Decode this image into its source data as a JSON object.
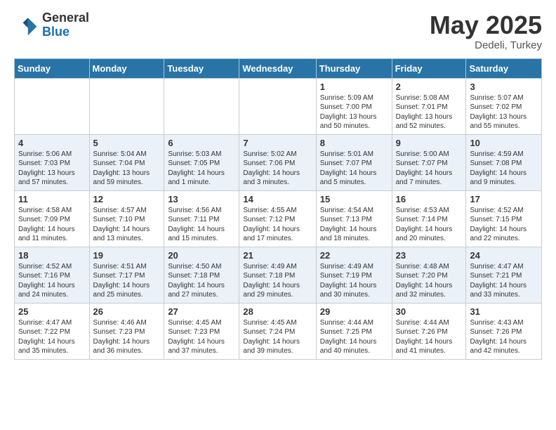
{
  "header": {
    "logo_general": "General",
    "logo_blue": "Blue",
    "month": "May 2025",
    "location": "Dedeli, Turkey"
  },
  "weekdays": [
    "Sunday",
    "Monday",
    "Tuesday",
    "Wednesday",
    "Thursday",
    "Friday",
    "Saturday"
  ],
  "weeks": [
    [
      {
        "day": "",
        "sunrise": "",
        "sunset": "",
        "daylight": ""
      },
      {
        "day": "",
        "sunrise": "",
        "sunset": "",
        "daylight": ""
      },
      {
        "day": "",
        "sunrise": "",
        "sunset": "",
        "daylight": ""
      },
      {
        "day": "",
        "sunrise": "",
        "sunset": "",
        "daylight": ""
      },
      {
        "day": "1",
        "sunrise": "Sunrise: 5:09 AM",
        "sunset": "Sunset: 7:00 PM",
        "daylight": "Daylight: 13 hours and 50 minutes."
      },
      {
        "day": "2",
        "sunrise": "Sunrise: 5:08 AM",
        "sunset": "Sunset: 7:01 PM",
        "daylight": "Daylight: 13 hours and 52 minutes."
      },
      {
        "day": "3",
        "sunrise": "Sunrise: 5:07 AM",
        "sunset": "Sunset: 7:02 PM",
        "daylight": "Daylight: 13 hours and 55 minutes."
      }
    ],
    [
      {
        "day": "4",
        "sunrise": "Sunrise: 5:06 AM",
        "sunset": "Sunset: 7:03 PM",
        "daylight": "Daylight: 13 hours and 57 minutes."
      },
      {
        "day": "5",
        "sunrise": "Sunrise: 5:04 AM",
        "sunset": "Sunset: 7:04 PM",
        "daylight": "Daylight: 13 hours and 59 minutes."
      },
      {
        "day": "6",
        "sunrise": "Sunrise: 5:03 AM",
        "sunset": "Sunset: 7:05 PM",
        "daylight": "Daylight: 14 hours and 1 minute."
      },
      {
        "day": "7",
        "sunrise": "Sunrise: 5:02 AM",
        "sunset": "Sunset: 7:06 PM",
        "daylight": "Daylight: 14 hours and 3 minutes."
      },
      {
        "day": "8",
        "sunrise": "Sunrise: 5:01 AM",
        "sunset": "Sunset: 7:07 PM",
        "daylight": "Daylight: 14 hours and 5 minutes."
      },
      {
        "day": "9",
        "sunrise": "Sunrise: 5:00 AM",
        "sunset": "Sunset: 7:07 PM",
        "daylight": "Daylight: 14 hours and 7 minutes."
      },
      {
        "day": "10",
        "sunrise": "Sunrise: 4:59 AM",
        "sunset": "Sunset: 7:08 PM",
        "daylight": "Daylight: 14 hours and 9 minutes."
      }
    ],
    [
      {
        "day": "11",
        "sunrise": "Sunrise: 4:58 AM",
        "sunset": "Sunset: 7:09 PM",
        "daylight": "Daylight: 14 hours and 11 minutes."
      },
      {
        "day": "12",
        "sunrise": "Sunrise: 4:57 AM",
        "sunset": "Sunset: 7:10 PM",
        "daylight": "Daylight: 14 hours and 13 minutes."
      },
      {
        "day": "13",
        "sunrise": "Sunrise: 4:56 AM",
        "sunset": "Sunset: 7:11 PM",
        "daylight": "Daylight: 14 hours and 15 minutes."
      },
      {
        "day": "14",
        "sunrise": "Sunrise: 4:55 AM",
        "sunset": "Sunset: 7:12 PM",
        "daylight": "Daylight: 14 hours and 17 minutes."
      },
      {
        "day": "15",
        "sunrise": "Sunrise: 4:54 AM",
        "sunset": "Sunset: 7:13 PM",
        "daylight": "Daylight: 14 hours and 18 minutes."
      },
      {
        "day": "16",
        "sunrise": "Sunrise: 4:53 AM",
        "sunset": "Sunset: 7:14 PM",
        "daylight": "Daylight: 14 hours and 20 minutes."
      },
      {
        "day": "17",
        "sunrise": "Sunrise: 4:52 AM",
        "sunset": "Sunset: 7:15 PM",
        "daylight": "Daylight: 14 hours and 22 minutes."
      }
    ],
    [
      {
        "day": "18",
        "sunrise": "Sunrise: 4:52 AM",
        "sunset": "Sunset: 7:16 PM",
        "daylight": "Daylight: 14 hours and 24 minutes."
      },
      {
        "day": "19",
        "sunrise": "Sunrise: 4:51 AM",
        "sunset": "Sunset: 7:17 PM",
        "daylight": "Daylight: 14 hours and 25 minutes."
      },
      {
        "day": "20",
        "sunrise": "Sunrise: 4:50 AM",
        "sunset": "Sunset: 7:18 PM",
        "daylight": "Daylight: 14 hours and 27 minutes."
      },
      {
        "day": "21",
        "sunrise": "Sunrise: 4:49 AM",
        "sunset": "Sunset: 7:18 PM",
        "daylight": "Daylight: 14 hours and 29 minutes."
      },
      {
        "day": "22",
        "sunrise": "Sunrise: 4:49 AM",
        "sunset": "Sunset: 7:19 PM",
        "daylight": "Daylight: 14 hours and 30 minutes."
      },
      {
        "day": "23",
        "sunrise": "Sunrise: 4:48 AM",
        "sunset": "Sunset: 7:20 PM",
        "daylight": "Daylight: 14 hours and 32 minutes."
      },
      {
        "day": "24",
        "sunrise": "Sunrise: 4:47 AM",
        "sunset": "Sunset: 7:21 PM",
        "daylight": "Daylight: 14 hours and 33 minutes."
      }
    ],
    [
      {
        "day": "25",
        "sunrise": "Sunrise: 4:47 AM",
        "sunset": "Sunset: 7:22 PM",
        "daylight": "Daylight: 14 hours and 35 minutes."
      },
      {
        "day": "26",
        "sunrise": "Sunrise: 4:46 AM",
        "sunset": "Sunset: 7:23 PM",
        "daylight": "Daylight: 14 hours and 36 minutes."
      },
      {
        "day": "27",
        "sunrise": "Sunrise: 4:45 AM",
        "sunset": "Sunset: 7:23 PM",
        "daylight": "Daylight: 14 hours and 37 minutes."
      },
      {
        "day": "28",
        "sunrise": "Sunrise: 4:45 AM",
        "sunset": "Sunset: 7:24 PM",
        "daylight": "Daylight: 14 hours and 39 minutes."
      },
      {
        "day": "29",
        "sunrise": "Sunrise: 4:44 AM",
        "sunset": "Sunset: 7:25 PM",
        "daylight": "Daylight: 14 hours and 40 minutes."
      },
      {
        "day": "30",
        "sunrise": "Sunrise: 4:44 AM",
        "sunset": "Sunset: 7:26 PM",
        "daylight": "Daylight: 14 hours and 41 minutes."
      },
      {
        "day": "31",
        "sunrise": "Sunrise: 4:43 AM",
        "sunset": "Sunset: 7:26 PM",
        "daylight": "Daylight: 14 hours and 42 minutes."
      }
    ]
  ]
}
